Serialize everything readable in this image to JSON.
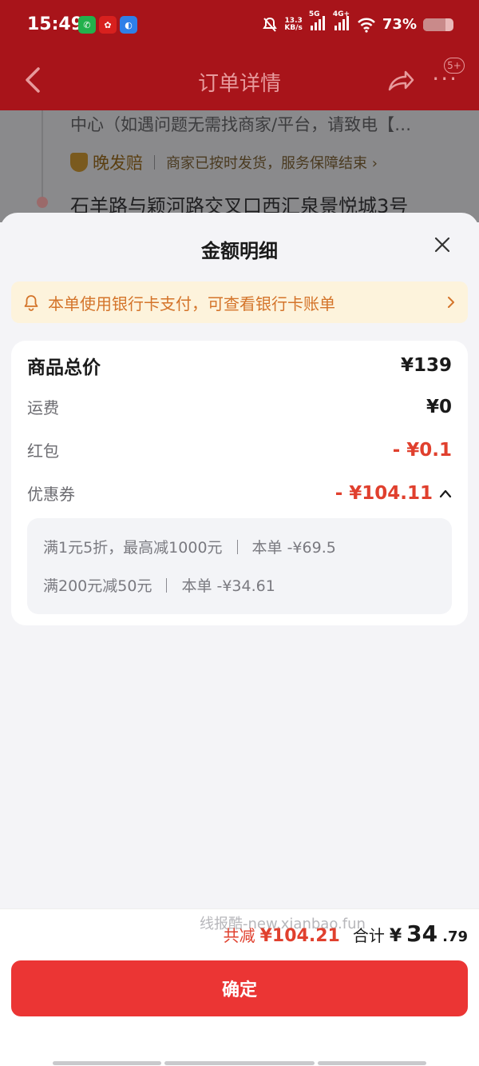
{
  "status_bar": {
    "time": "15:49",
    "net_speed_top": "13.3",
    "net_speed_bottom": "KB/s",
    "net_5g": "5G",
    "net_4g": "4G+",
    "battery": "73%",
    "battery_fraction": 0.73
  },
  "nav": {
    "title": "订单详情",
    "badge": "5+"
  },
  "underlay": {
    "line1": "中心（如遇问题无需找商家/平台，请致电【…",
    "late_label": "晚发赔",
    "late_status": "商家已按时发货，服务保障结束 ›",
    "address": "石羊路与颖河路交叉口西汇泉景悦城3号"
  },
  "sheet": {
    "title": "金额明细",
    "notice": "本单使用银行卡支付，可查看银行卡账单",
    "rows": {
      "total_label": "商品总价",
      "total_value": "¥139",
      "shipping_label": "运费",
      "shipping_value": "¥0",
      "redpacket_label": "红包",
      "redpacket_value": "- ¥0.1",
      "coupon_label": "优惠券",
      "coupon_value": "- ¥104.11"
    },
    "coupons": [
      {
        "rule": "满1元5折，最高减1000元",
        "applied": "本单 -¥69.5"
      },
      {
        "rule": "满200元减50元",
        "applied": "本单 -¥34.61"
      }
    ]
  },
  "footer": {
    "watermark": "线报酷-new.xianbao.fun",
    "saved_label": "共减",
    "saved_value": "¥104.21",
    "total_label": "合计",
    "total_currency": "¥",
    "total_int": "34",
    "total_dec": ".79",
    "confirm_label": "确定"
  },
  "colors": {
    "accent_red": "#eb3534",
    "discount_red": "#e0402e",
    "notice_bg": "#fdf3dc",
    "notice_text": "#d4742a"
  }
}
